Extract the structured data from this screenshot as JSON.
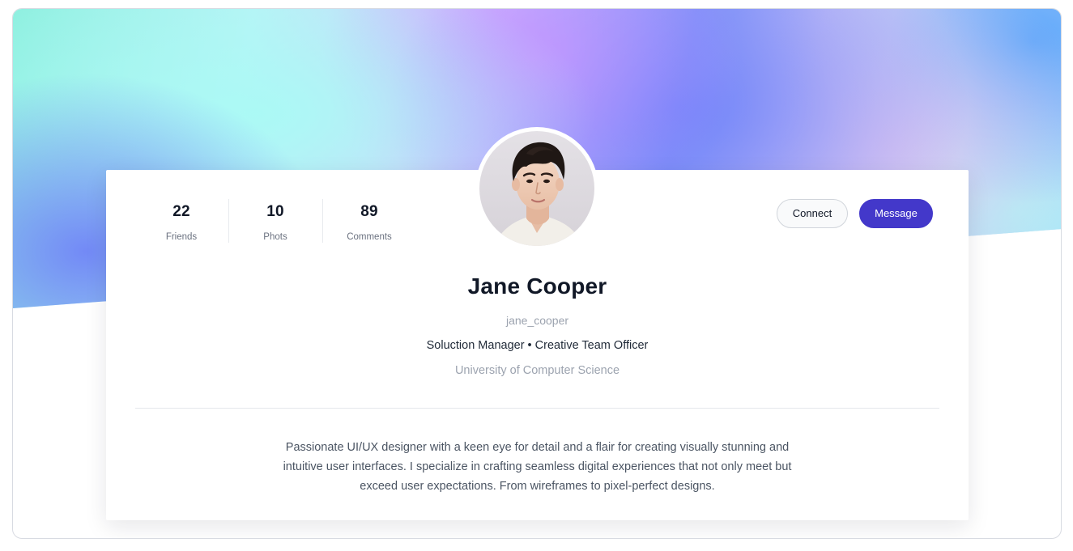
{
  "profile": {
    "stats": [
      {
        "value": "22",
        "label": "Friends"
      },
      {
        "value": "10",
        "label": "Phots"
      },
      {
        "value": "89",
        "label": "Comments"
      }
    ],
    "actions": {
      "connect_label": "Connect",
      "message_label": "Message"
    },
    "name": "Jane Cooper",
    "username": "jane_cooper",
    "role": "Soluction Manager • Creative Team Officer",
    "school": "University of Computer Science",
    "bio": "Passionate UI/UX designer with a keen eye for detail and a flair for creating visually stunning and intuitive user interfaces. I specialize in crafting seamless digital experiences that not only meet but exceed user expectations. From wireframes to pixel-perfect designs."
  },
  "colors": {
    "accent": "#4338ca",
    "text_primary": "#111827",
    "text_muted": "#9ca3af"
  },
  "icons": {
    "avatar": "profile-photo"
  }
}
